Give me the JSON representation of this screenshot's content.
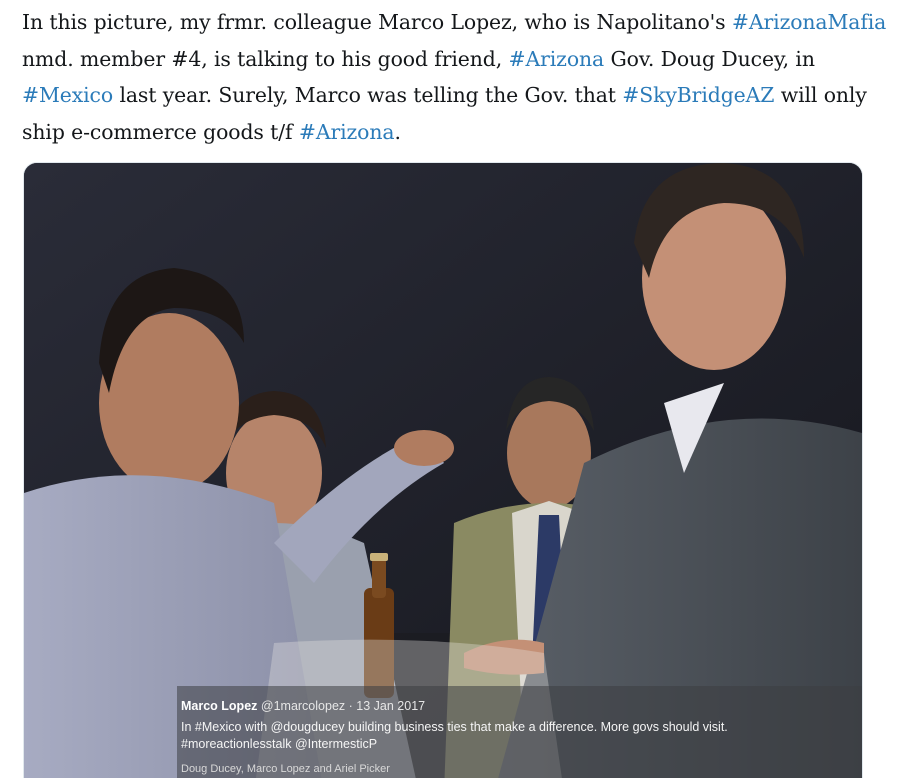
{
  "tweet": {
    "lines": [
      [
        {
          "t": "In this picture, my frmr. colleague Marco Lopez, who is Napolitano's ",
          "tag": false
        },
        {
          "t": "#ArizonaMafia",
          "tag": true
        }
      ],
      [
        {
          "t": "nmd. member #4, is talking to his good friend, ",
          "tag": false
        },
        {
          "t": "#Arizona",
          "tag": true
        },
        {
          "t": " Gov. Doug Ducey, in",
          "tag": false
        }
      ],
      [
        {
          "t": "#Mexico",
          "tag": true
        },
        {
          "t": " last year. Surely, Marco was telling the Gov. that ",
          "tag": false
        },
        {
          "t": "#SkyBridgeAZ",
          "tag": true
        },
        {
          "t": " will only",
          "tag": false
        }
      ],
      [
        {
          "t": "ship e-commerce goods t/f ",
          "tag": false
        },
        {
          "t": "#Arizona",
          "tag": true
        },
        {
          "t": ".",
          "tag": false
        }
      ]
    ]
  },
  "quoted": {
    "author_name": "Marco Lopez",
    "author_handle": "@1marcolopez",
    "separator": "·",
    "date": "13 Jan 2017",
    "body": "In #Mexico with @dougducey building business ties that make a difference.  More govs should visit. #moreactionlesstalk @IntermesticP",
    "tagged": "Doug Ducey, Marco Lopez and Ariel Picker"
  },
  "colors": {
    "hashtag": "#2b7bb9",
    "text": "#14171a"
  }
}
